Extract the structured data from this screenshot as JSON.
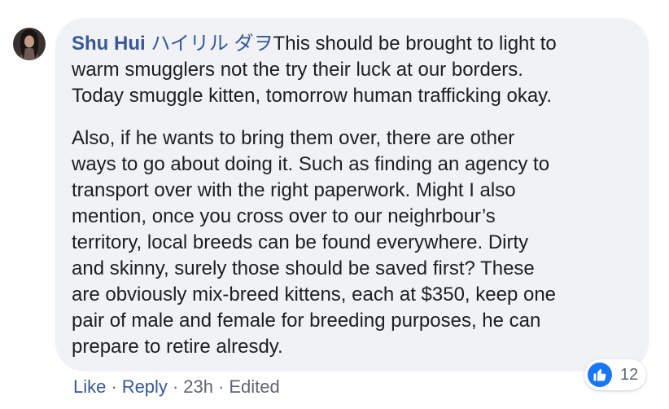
{
  "comment": {
    "author_name": "Shu Hui",
    "author_alt_name": "ハイリル ダヲ",
    "paragraph1": [
      "This should be brought to light to",
      "warm smugglers not the try their luck at our borders.",
      "Today smuggle kitten, tomorrow human trafficking okay."
    ],
    "paragraph2": [
      "Also, if he wants to bring them over, there are other",
      "ways to go about doing it. Such as finding an agency to",
      "transport over with the right paperwork. Might I also",
      "mention, once you cross over to our neighrbour’s",
      "territory, local breeds can be found everywhere. Dirty",
      "and skinny, surely those should be saved first? These",
      "are obviously mix-breed kittens, each at $350, keep one",
      "pair of male and female for breeding purposes, he can",
      "prepare to retire alresdy."
    ]
  },
  "actions": {
    "like_label": "Like",
    "reply_label": "Reply",
    "separator": "·",
    "timestamp": "23h",
    "edited_label": "Edited"
  },
  "reactions": {
    "icon": "thumbs-up-icon",
    "count": "12",
    "color": "#1877f2"
  },
  "colors": {
    "bubble_bg": "#f0f2f5",
    "author": "#385898",
    "text": "#1c1e21",
    "meta": "#606770"
  }
}
